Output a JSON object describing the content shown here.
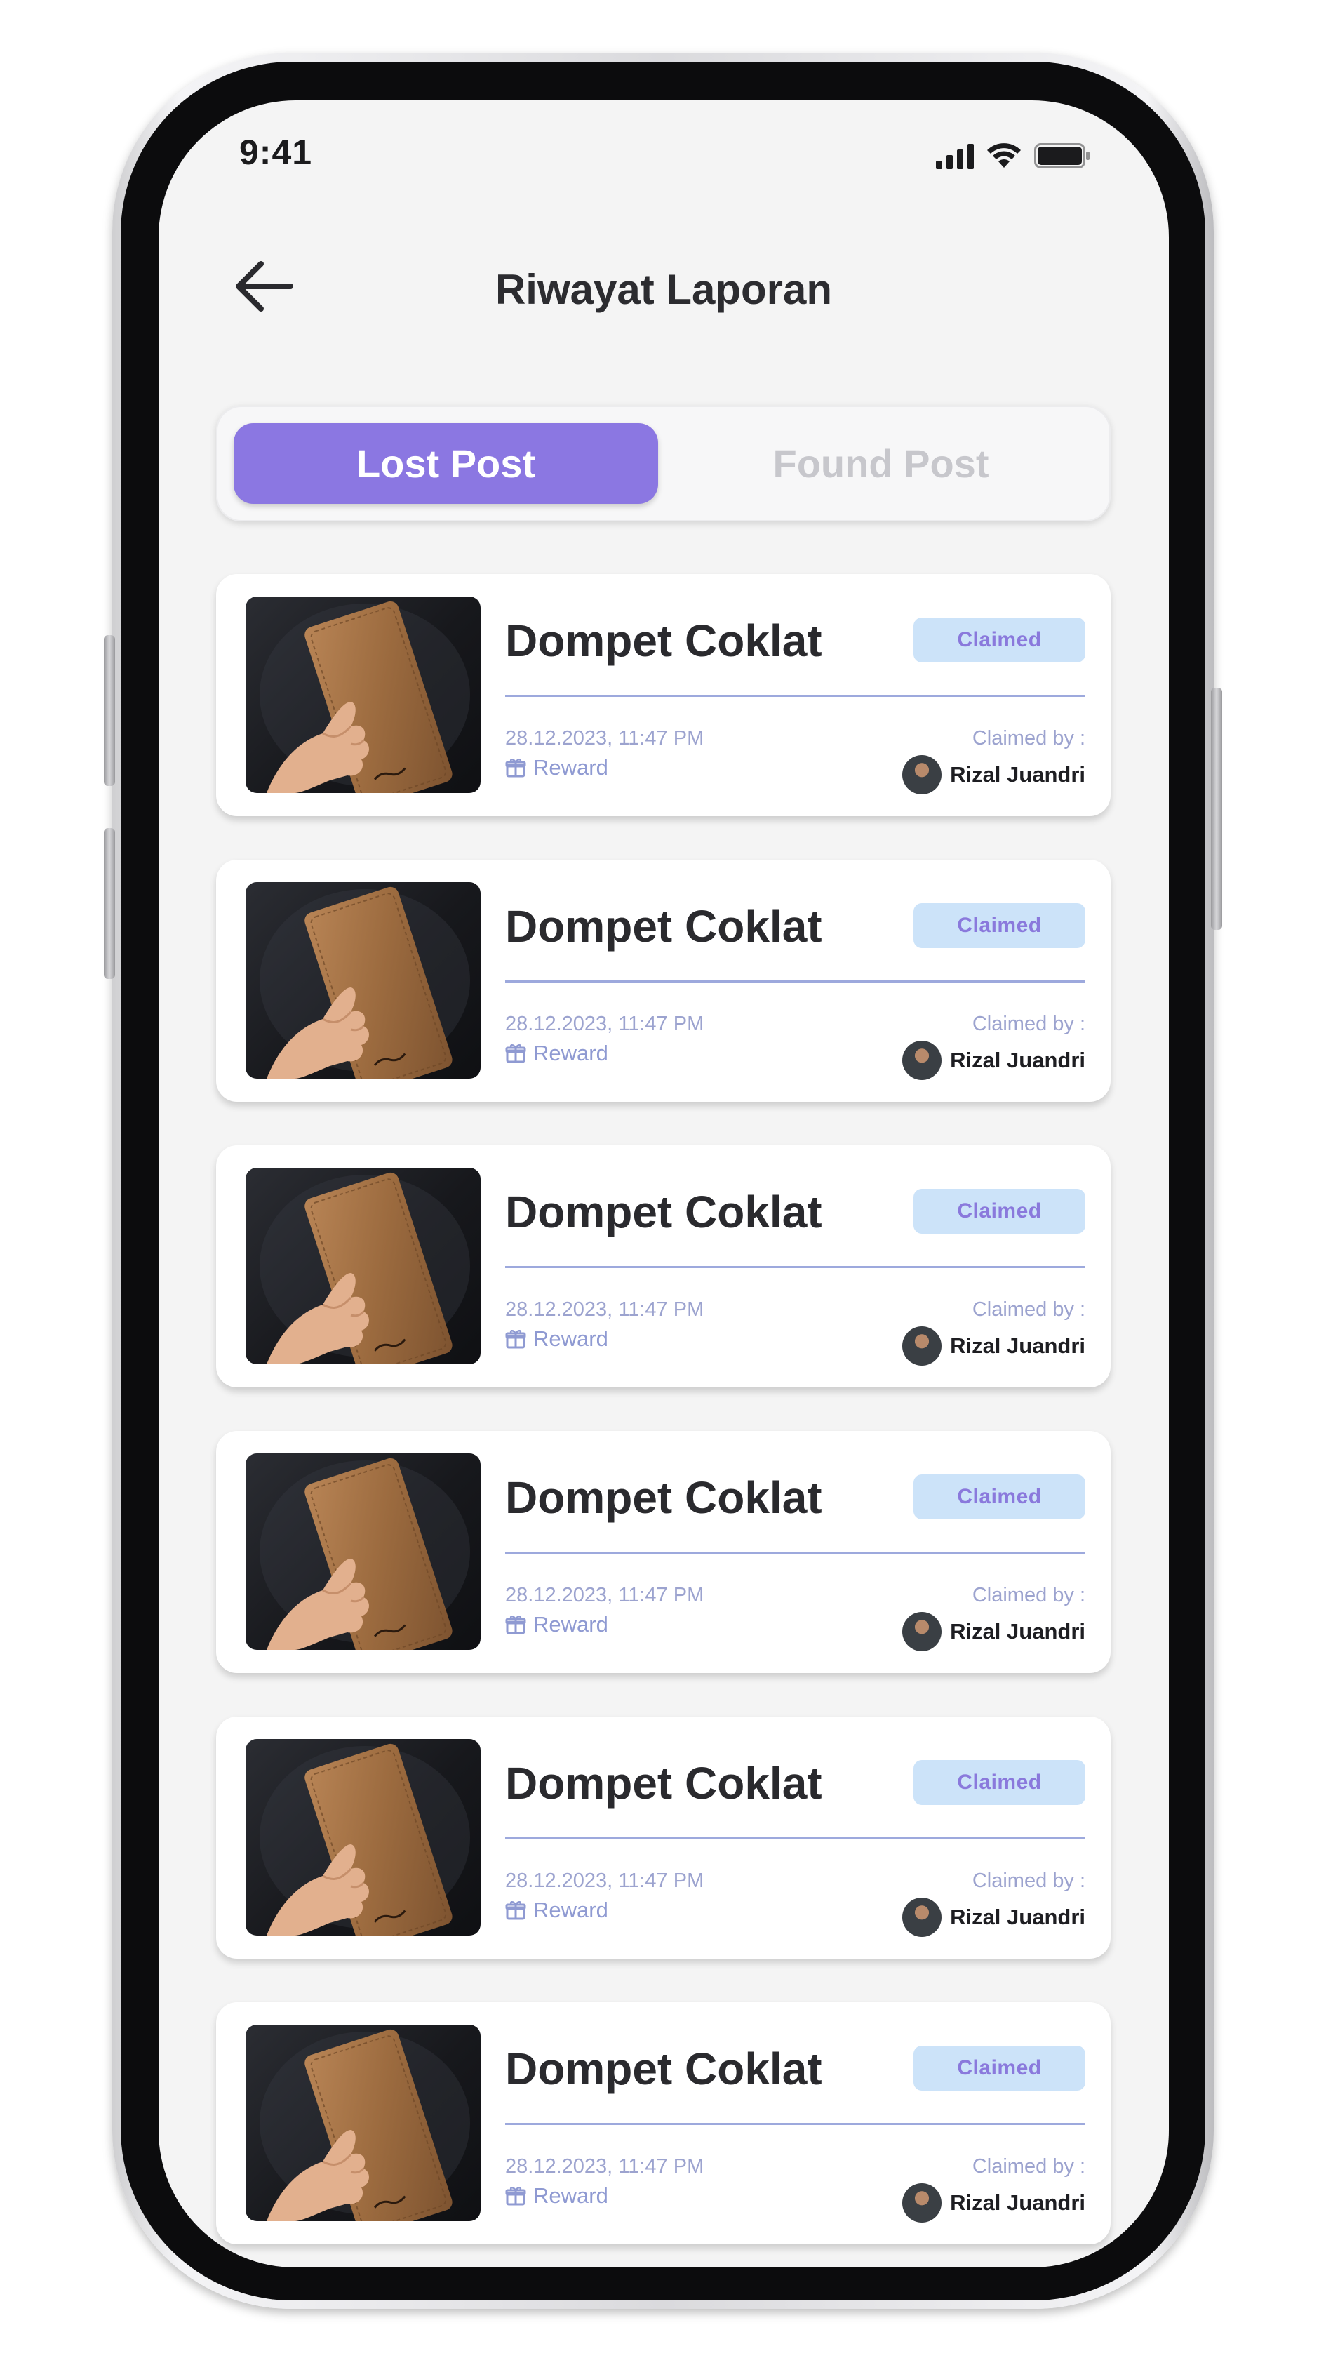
{
  "status_bar": {
    "time": "9:41",
    "icons": [
      "signal-icon",
      "wifi-icon",
      "battery-icon"
    ]
  },
  "header": {
    "back_icon": "arrow-left-icon",
    "title": "Riwayat Laporan"
  },
  "tabs": [
    {
      "label": "Lost Post",
      "active": true
    },
    {
      "label": "Found Post",
      "active": false
    }
  ],
  "colors": {
    "accent": "#8b77e2",
    "badge_bg": "#cce3f9",
    "badge_text": "#8a79dc",
    "divider": "#9da9dd",
    "muted_text": "#9ca3cf",
    "screen_bg": "#f4f4f4"
  },
  "posts": [
    {
      "title": "Dompet Coklat",
      "status": "Claimed",
      "date": "28.12.2023, 11:47 PM",
      "reward_label": "Reward",
      "claimed_by_label": "Claimed by :",
      "claimer": "Rizal Juandri",
      "image": "brown-wallet-photo"
    },
    {
      "title": "Dompet Coklat",
      "status": "Claimed",
      "date": "28.12.2023, 11:47 PM",
      "reward_label": "Reward",
      "claimed_by_label": "Claimed by :",
      "claimer": "Rizal Juandri",
      "image": "brown-wallet-photo"
    },
    {
      "title": "Dompet Coklat",
      "status": "Claimed",
      "date": "28.12.2023, 11:47 PM",
      "reward_label": "Reward",
      "claimed_by_label": "Claimed by :",
      "claimer": "Rizal Juandri",
      "image": "brown-wallet-photo"
    },
    {
      "title": "Dompet Coklat",
      "status": "Claimed",
      "date": "28.12.2023, 11:47 PM",
      "reward_label": "Reward",
      "claimed_by_label": "Claimed by :",
      "claimer": "Rizal Juandri",
      "image": "brown-wallet-photo"
    },
    {
      "title": "Dompet Coklat",
      "status": "Claimed",
      "date": "28.12.2023, 11:47 PM",
      "reward_label": "Reward",
      "claimed_by_label": "Claimed by :",
      "claimer": "Rizal Juandri",
      "image": "brown-wallet-photo"
    },
    {
      "title": "Dompet Coklat",
      "status": "Claimed",
      "date": "28.12.2023, 11:47 PM",
      "reward_label": "Reward",
      "claimed_by_label": "Claimed by :",
      "claimer": "Rizal Juandri",
      "image": "brown-wallet-photo"
    }
  ]
}
